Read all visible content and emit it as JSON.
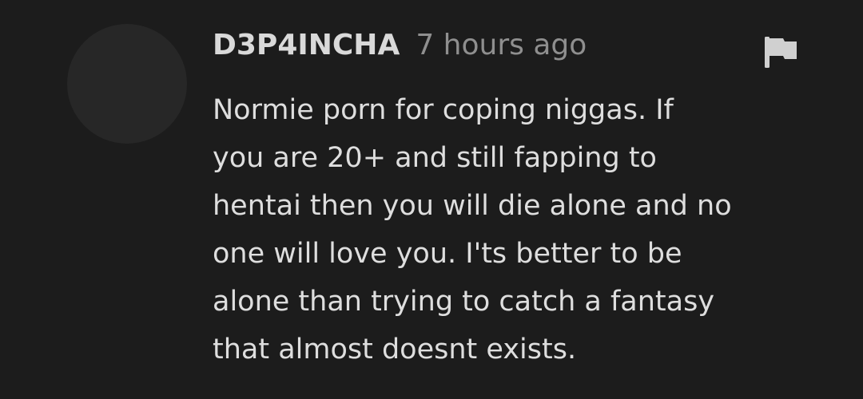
{
  "comment": {
    "username": "D3P4INCHA",
    "timestamp": "7 hours ago",
    "flag_icon": "flag-icon",
    "body_lines": [
      "Normie porn for coping niggas. If",
      "you are 20+ and still fapping to",
      "hentai then you will die alone and no",
      "one will love you. I'ts better to be",
      "alone than trying to catch a fantasy",
      "that almost doesnt exists."
    ]
  },
  "colors": {
    "background": "#1c1c1c",
    "avatar": "#272727",
    "username": "#d9d9d9",
    "timestamp": "#8f8f8f",
    "body": "#dedede",
    "icon": "#d0d0d0"
  }
}
